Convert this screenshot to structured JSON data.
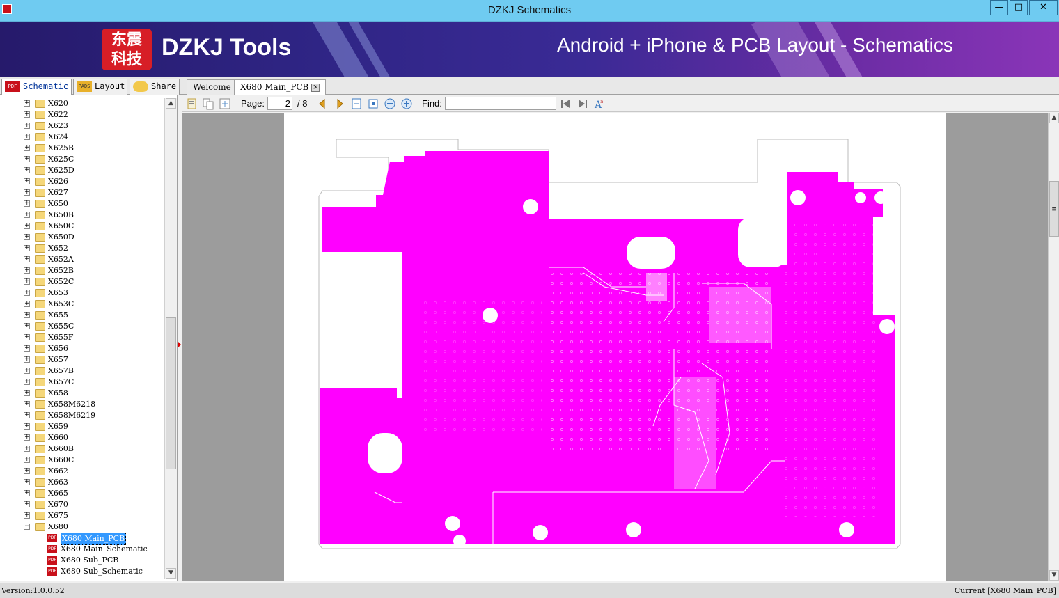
{
  "window": {
    "title": "DZKJ Schematics",
    "controls": [
      "minimize",
      "maximize",
      "close"
    ]
  },
  "banner": {
    "logo_text_top": "东震",
    "logo_text_bottom": "科技",
    "brand": "DZKJ Tools",
    "tagline": "Android + iPhone & PCB Layout - Schematics"
  },
  "left_tabs": [
    {
      "label": "Schematic",
      "icon": "pdf-icon",
      "active": true
    },
    {
      "label": "Layout",
      "icon": "pads-icon",
      "active": false
    },
    {
      "label": "Share",
      "icon": "cloud-share-icon",
      "active": false
    }
  ],
  "doc_tabs": [
    {
      "label": "Welcome",
      "active": false
    },
    {
      "label": "X680 Main_PCB",
      "active": true
    }
  ],
  "tree": {
    "folders": [
      "X620",
      "X622",
      "X623",
      "X624",
      "X625B",
      "X625C",
      "X625D",
      "X626",
      "X627",
      "X650",
      "X650B",
      "X650C",
      "X650D",
      "X652",
      "X652A",
      "X652B",
      "X652C",
      "X653",
      "X653C",
      "X655",
      "X655C",
      "X655F",
      "X656",
      "X657",
      "X657B",
      "X657C",
      "X658",
      "X658M6218",
      "X658M6219",
      "X659",
      "X660",
      "X660B",
      "X660C",
      "X662",
      "X663",
      "X665",
      "X670",
      "X675"
    ],
    "expanded_folder": "X680",
    "files": [
      {
        "label": "X680 Main_PCB",
        "selected": true
      },
      {
        "label": "X680 Main_Schematic",
        "selected": false
      },
      {
        "label": "X680 Sub_PCB",
        "selected": false
      },
      {
        "label": "X680 Sub_Schematic",
        "selected": false
      }
    ]
  },
  "toolbar": {
    "page_label": "Page:",
    "page_current": "2",
    "page_total": "/ 8",
    "find_label": "Find:",
    "find_value": ""
  },
  "viewer": {
    "board_color": "#ff00ff",
    "background": "#9c9c9c"
  },
  "status": {
    "version": "Version:1.0.0.52",
    "current": "Current [X680 Main_PCB]"
  }
}
